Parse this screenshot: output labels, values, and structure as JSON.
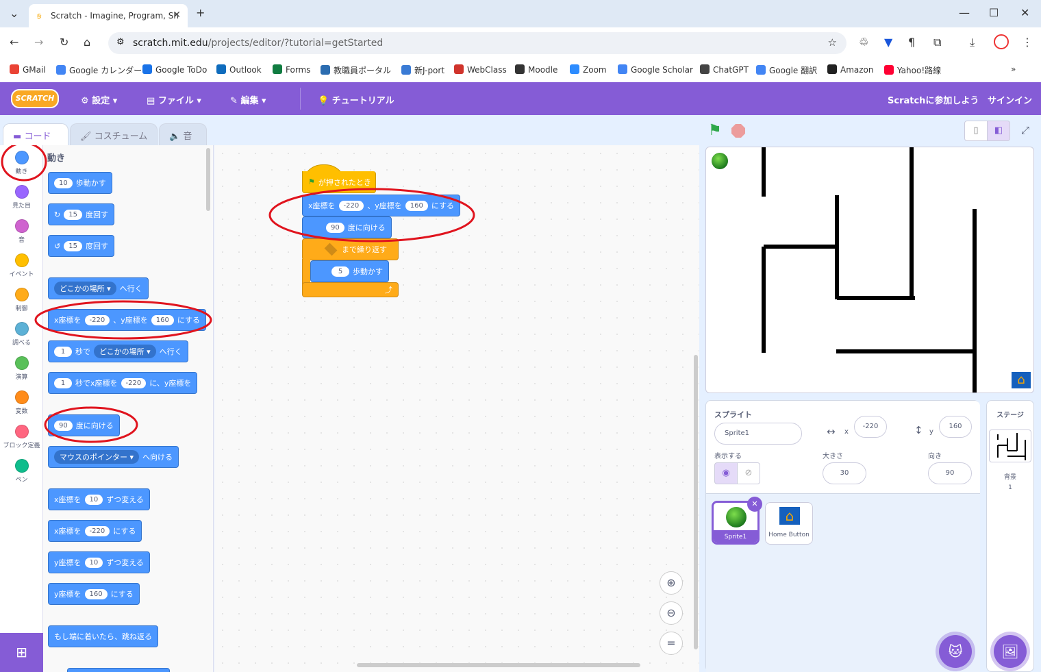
{
  "browser": {
    "tab_title": "Scratch - Imagine, Program, Sh",
    "url_host": "scratch.mit.edu",
    "url_path": "/projects/editor/?tutorial=getStarted",
    "bookmarks": [
      {
        "label": "GMail",
        "color": "#ea4335"
      },
      {
        "label": "Google カレンダー",
        "color": "#4285f4"
      },
      {
        "label": "Google ToDo",
        "color": "#1a73e8"
      },
      {
        "label": "Outlook",
        "color": "#0f6cbd"
      },
      {
        "label": "Forms",
        "color": "#107c41"
      },
      {
        "label": "教職員ポータル",
        "color": "#2b6cb0"
      },
      {
        "label": "新J-port",
        "color": "#3a7bd5"
      },
      {
        "label": "WebClass",
        "color": "#d0342c"
      },
      {
        "label": "Moodle",
        "color": "#333333"
      },
      {
        "label": "Zoom",
        "color": "#2d8cff"
      },
      {
        "label": "Google Scholar",
        "color": "#4285f4"
      },
      {
        "label": "ChatGPT",
        "color": "#444444"
      },
      {
        "label": "Google 翻訳",
        "color": "#4285f4"
      },
      {
        "label": "Amazon",
        "color": "#222222"
      },
      {
        "label": "Yahoo!路線",
        "color": "#ff0033"
      }
    ]
  },
  "menu": {
    "logo": "SCRATCH",
    "settings": "設定",
    "file": "ファイル",
    "edit": "編集",
    "tutorial": "チュートリアル",
    "join": "Scratchに参加しよう",
    "signin": "サインイン"
  },
  "tabs": {
    "code": "コード",
    "costume": "コスチューム",
    "sound": "音"
  },
  "categories": [
    {
      "label": "動き",
      "color": "#4c97ff"
    },
    {
      "label": "見た目",
      "color": "#9966ff"
    },
    {
      "label": "音",
      "color": "#cf63cf"
    },
    {
      "label": "イベント",
      "color": "#ffbf00"
    },
    {
      "label": "制御",
      "color": "#ffab19"
    },
    {
      "label": "調べる",
      "color": "#5cb1d6"
    },
    {
      "label": "演算",
      "color": "#59c059"
    },
    {
      "label": "変数",
      "color": "#ff8c1a"
    },
    {
      "label": "ブロック定義",
      "color": "#ff6680"
    },
    {
      "label": "ペン",
      "color": "#0fbd8c"
    }
  ],
  "palette": {
    "heading": "動き",
    "move_steps": {
      "value": "10",
      "text": "歩動かす"
    },
    "turn_right": {
      "value": "15",
      "text": "度回す"
    },
    "turn_left": {
      "value": "15",
      "text": "度回す"
    },
    "goto": {
      "dropdown": "どこかの場所",
      "text": "へ行く"
    },
    "goto_xy": {
      "a": "x座標を",
      "x": "-220",
      "b": "、y座標を",
      "y": "160",
      "c": "にする"
    },
    "glide": {
      "value": "1",
      "a": "秒で",
      "dropdown": "どこかの場所",
      "b": "へ行く"
    },
    "glide_xy": {
      "value": "1",
      "a": "秒でx座標を",
      "x": "-220",
      "b": "に、y座標を"
    },
    "point_dir": {
      "value": "90",
      "text": "度に向ける"
    },
    "point_towards": {
      "dropdown": "マウスのポインター",
      "text": "へ向ける"
    },
    "change_x": {
      "a": "x座標を",
      "value": "10",
      "b": "ずつ変える"
    },
    "set_x": {
      "a": "x座標を",
      "value": "-220",
      "b": "にする"
    },
    "change_y": {
      "a": "y座標を",
      "value": "10",
      "b": "ずつ変える"
    },
    "set_y": {
      "a": "y座標を",
      "value": "160",
      "b": "にする"
    },
    "bounce": "もし端に着いたら、跳ね返る"
  },
  "script": {
    "hat": "が押されたとき",
    "goto": {
      "a": "x座標を",
      "x": "-220",
      "b": "、y座標を",
      "y": "160",
      "c": "にする"
    },
    "point": {
      "value": "90",
      "text": "度に向ける"
    },
    "repeat_until": "まで繰り返す",
    "move": {
      "value": "5",
      "text": "歩動かす"
    }
  },
  "sprite_info": {
    "label": "スプライト",
    "name": "Sprite1",
    "x_label": "x",
    "x": "-220",
    "y_label": "y",
    "y": "160",
    "show_label": "表示する",
    "size_label": "大きさ",
    "size": "30",
    "dir_label": "向き",
    "dir": "90"
  },
  "sprites": [
    {
      "name": "Sprite1",
      "selected": true
    },
    {
      "name": "Home Button",
      "selected": false
    }
  ],
  "stage_panel": {
    "label": "ステージ",
    "backdrop_label": "背景",
    "backdrop_count": "1"
  },
  "colors": {
    "scratch_purple": "#855cd6",
    "motion": "#4c97ff",
    "control": "#ffab19",
    "annotation_red": "#e0141e"
  }
}
